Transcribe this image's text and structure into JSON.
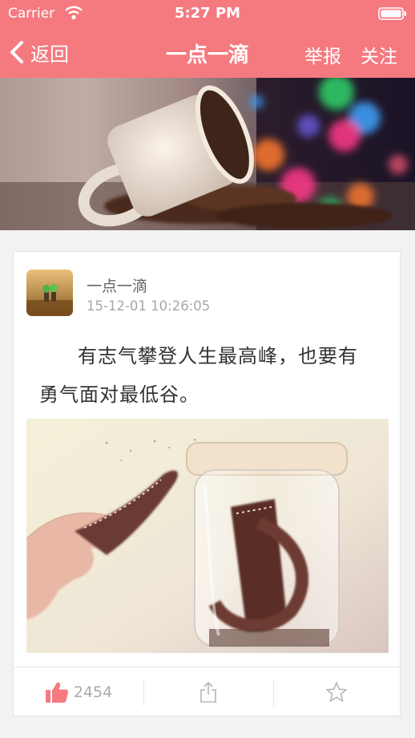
{
  "status_bar": {
    "carrier": "Carrier",
    "time": "5:27 PM"
  },
  "nav": {
    "back_label": "返回",
    "title": "一点一滴",
    "report_label": "举报",
    "follow_label": "关注"
  },
  "post": {
    "author": "一点一滴",
    "timestamp": "15-12-01 10:26:05",
    "content": "有志气攀登人生最高峰，也要有勇气面对最低谷。",
    "like_count": "2454"
  },
  "colors": {
    "accent": "#f47a80",
    "like_icon": "#f47a80",
    "icon_gray": "#b5b5b5"
  },
  "icons": {
    "back": "chevron-left-icon",
    "like": "thumbs-up-icon",
    "share": "share-icon",
    "favorite": "star-icon"
  }
}
